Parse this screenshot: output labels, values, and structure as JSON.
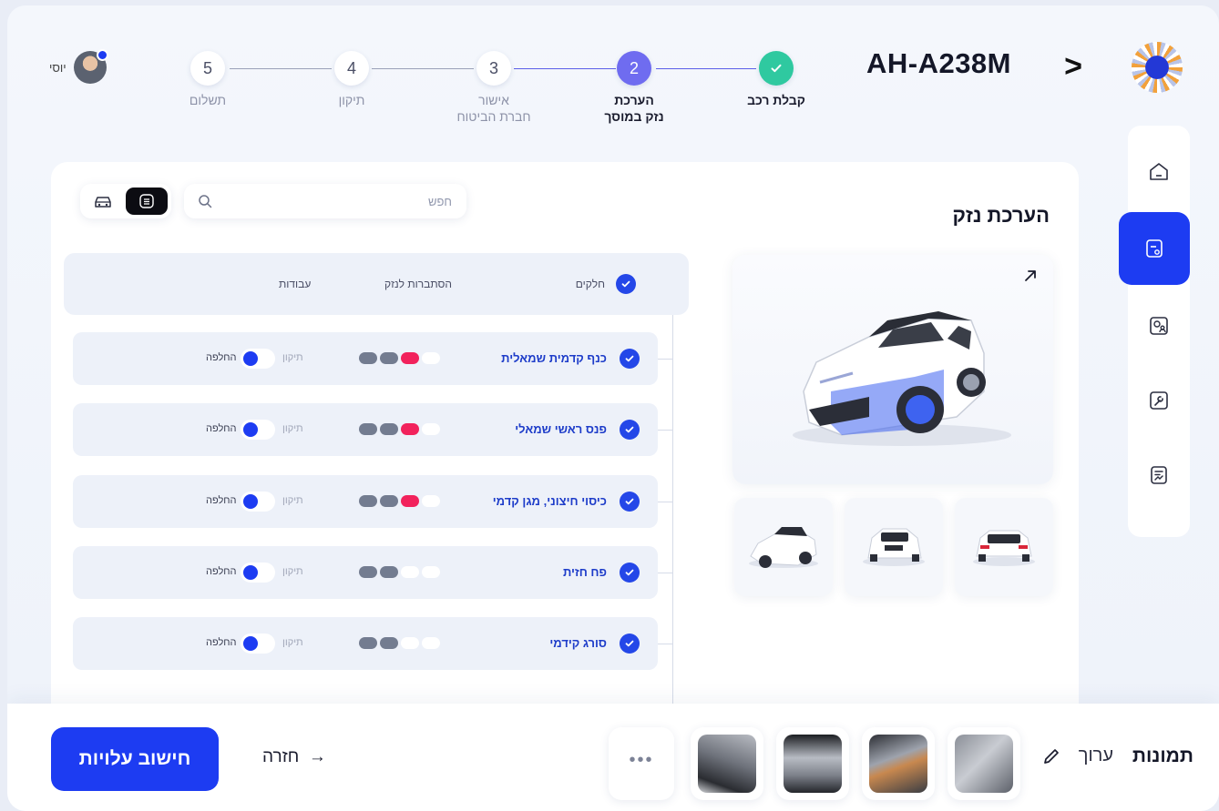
{
  "header": {
    "plate": "AH-A238M",
    "user_name": "יוסי",
    "steps": [
      {
        "number": "",
        "label1": "קבלת רכב",
        "label2": ""
      },
      {
        "number": "2",
        "label1": "הערכת",
        "label2": "נזק במוסך"
      },
      {
        "number": "3",
        "label1": "אישור",
        "label2": "חברת הביטוח"
      },
      {
        "number": "4",
        "label1": "תיקון",
        "label2": ""
      },
      {
        "number": "5",
        "label1": "תשלום",
        "label2": ""
      }
    ]
  },
  "sidebar": {
    "items": [
      {
        "icon": "home-icon"
      },
      {
        "icon": "document-settings-icon"
      },
      {
        "icon": "car-person-icon"
      },
      {
        "icon": "wrench-icon"
      },
      {
        "icon": "report-chart-icon"
      }
    ]
  },
  "panel": {
    "title": "הערכת נזק",
    "search_placeholder": "חפש",
    "columns": {
      "parts": "חלקים",
      "probability": "הסתברות לנזק",
      "works": "עבודות"
    },
    "rows": [
      {
        "part": "כנף קדמית שמאלית",
        "probability_level": 3,
        "repair_label": "תיקון",
        "replace_label": "החלפה"
      },
      {
        "part": "פנס ראשי שמאלי",
        "probability_level": 3,
        "repair_label": "תיקון",
        "replace_label": "החלפה"
      },
      {
        "part": "כיסוי חיצוני, מגן קדמי",
        "probability_level": 3,
        "repair_label": "תיקון",
        "replace_label": "החלפה"
      },
      {
        "part": "פח חזית",
        "probability_level": 2,
        "repair_label": "תיקון",
        "replace_label": "החלפה"
      },
      {
        "part": "סורג קידמי",
        "probability_level": 2,
        "repair_label": "תיקון",
        "replace_label": "החלפה"
      }
    ]
  },
  "bottom": {
    "photos_title": "תמונות",
    "edit_label": "ערוך",
    "more_label": "•••",
    "back_label": "חזרה",
    "calc_button": "חישוב עלויות"
  },
  "colors": {
    "accent": "#1d3cf2",
    "done": "#2fc9a0",
    "active_step": "#6f6cf0",
    "danger": "#f2225c"
  }
}
